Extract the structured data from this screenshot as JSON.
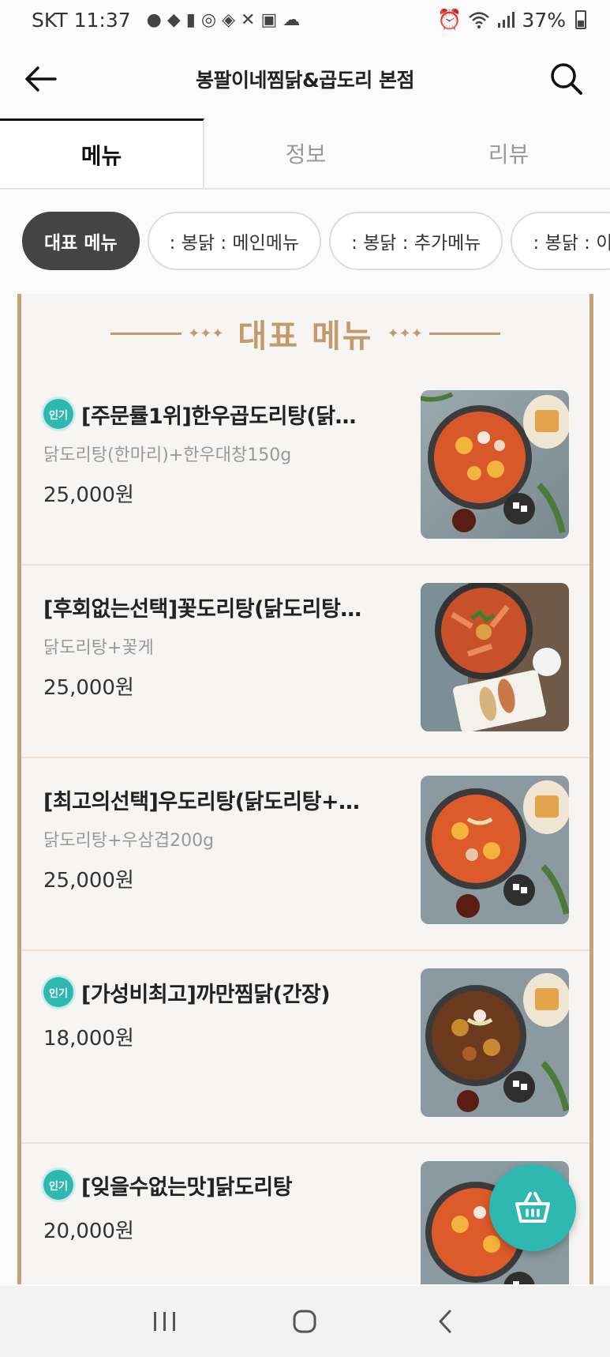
{
  "status_bar": {
    "carrier": "SKT",
    "time": "11:37",
    "battery": "37%",
    "icons": [
      "wifi-icon",
      "signal-icon",
      "battery-icon",
      "alarm-icon"
    ]
  },
  "header": {
    "title": "봉팔이네찜닭&곱도리 본점",
    "back_icon": "back-arrow-icon",
    "search_icon": "search-icon"
  },
  "tabs": [
    {
      "label": "메뉴",
      "active": true
    },
    {
      "label": "정보",
      "active": false
    },
    {
      "label": "리뷰",
      "active": false
    }
  ],
  "categories": [
    {
      "label": "대표 메뉴",
      "active": true
    },
    {
      "label": ": 봉닭 : 메인메뉴",
      "active": false
    },
    {
      "label": ": 봉닭 : 추가메뉴",
      "active": false
    },
    {
      "label": ": 봉닭 : 이",
      "active": false
    }
  ],
  "menu_section": {
    "title": "대표 메뉴",
    "items": [
      {
        "badge": "인기",
        "name": "[주문률1위]한우곱도리탕(닭…",
        "description": "닭도리탕(한마리)+한우대창150g",
        "price": "25,000원"
      },
      {
        "badge": "",
        "name": "[후회없는선택]꽃도리탕(닭도리탕…",
        "description": "닭도리탕+꽃게",
        "price": "25,000원"
      },
      {
        "badge": "",
        "name": "[최고의선택]우도리탕(닭도리탕+…",
        "description": "닭도리탕+우삼겹200g",
        "price": "25,000원"
      },
      {
        "badge": "인기",
        "name": "[가성비최고]까만찜닭(간장)",
        "description": "",
        "price": "18,000원"
      },
      {
        "badge": "인기",
        "name": "[잊을수없는맛]닭도리탕",
        "description": "",
        "price": "20,000원"
      }
    ]
  },
  "cart_button": {
    "icon": "basket-icon"
  },
  "colors": {
    "accent": "#2fb8b0",
    "gold": "#c39b6a",
    "chip_active": "#444444"
  }
}
